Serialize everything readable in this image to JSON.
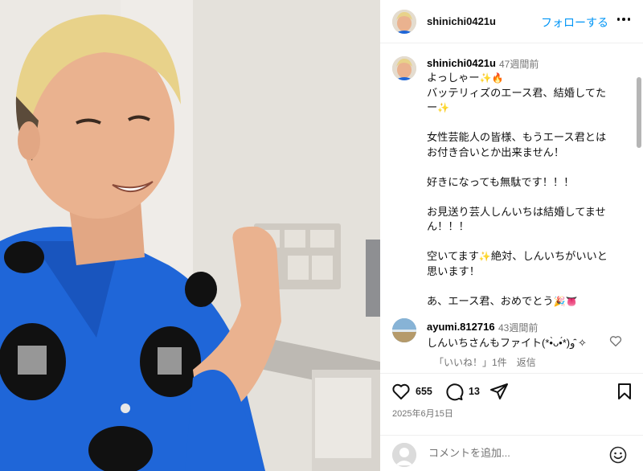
{
  "post": {
    "username": "shinichi0421u",
    "follow_label": "フォローする",
    "caption": {
      "username": "shinichi0421u",
      "time": "47週間前",
      "lines": [
        "よっしゃー",
        "バッテリィズのエース君、結婚してた",
        "ー",
        "",
        "女性芸能人の皆様、もうエース君とは",
        "お付き合いとか出来ません！",
        "",
        "好きになっても無駄です！！！",
        "",
        "お見送り芸人しんいちは結婚してませ",
        "ん！！！",
        "",
        "空いてます",
        "絶対、しんいちがいいと",
        "思います！",
        "",
        "あ、エース君、おめでとう"
      ]
    },
    "comment": {
      "username": "ayumi.812716",
      "time": "43週間前",
      "text": "しんいちさんもファイト(*•̀ᴗ•́*)و ̑̑✧",
      "likes_label": "「いいね！」1件",
      "reply_label": "返信"
    },
    "likes": "655",
    "comments_count": "13",
    "date": "2025年6月15日",
    "comment_placeholder": "コメントを追加...",
    "icons": {
      "more": "more-horizontal-icon",
      "like": "heart-icon",
      "comment": "comment-bubble-icon",
      "share": "paper-plane-icon",
      "save": "bookmark-icon",
      "emoji": "smiley-icon"
    },
    "colors": {
      "accent": "#0095f6",
      "muted": "#737373",
      "shirt": "#1f66d8"
    }
  }
}
